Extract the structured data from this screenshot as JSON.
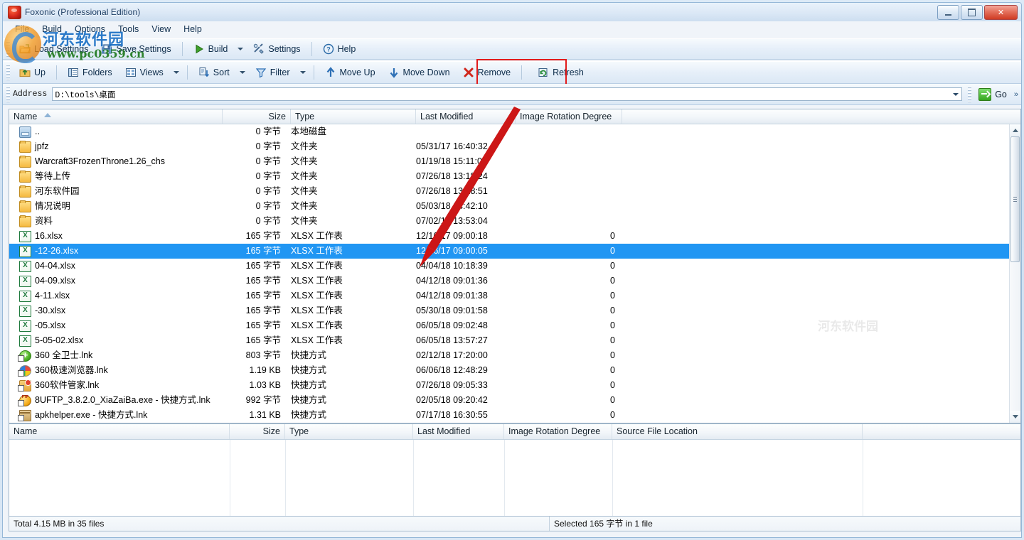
{
  "window": {
    "title": "Foxonic (Professional Edition)",
    "app_icon": "foxonic-icon",
    "minimize": "–",
    "maximize": "□",
    "close": "✕"
  },
  "menubar": {
    "items": [
      {
        "label": "File",
        "name": "menu-file"
      },
      {
        "label": "Build",
        "name": "menu-build"
      },
      {
        "label": "Options",
        "name": "menu-options"
      },
      {
        "label": "Tools",
        "name": "menu-tools"
      },
      {
        "label": "View",
        "name": "menu-view"
      },
      {
        "label": "Help",
        "name": "menu-help"
      }
    ]
  },
  "toolbar_main": {
    "load_settings": "Load Settings",
    "save_settings": "Save Settings",
    "build": "Build",
    "settings": "Settings",
    "help": "Help"
  },
  "toolbar_nav": {
    "up": "Up",
    "folders": "Folders",
    "views": "Views",
    "sort": "Sort",
    "filter": "Filter",
    "move_up": "Move Up",
    "move_down": "Move Down",
    "remove": "Remove",
    "refresh": "Refresh"
  },
  "address": {
    "label": "Address",
    "value": "D:\\tools\\桌面",
    "go": "Go",
    "overflow": "»"
  },
  "filelist": {
    "columns": [
      "Name",
      "Size",
      "Type",
      "Last Modified",
      "Image Rotation Degree"
    ],
    "sort_column": "Name",
    "sort_direction": "ascending",
    "rows": [
      {
        "icon": "drive-icon",
        "name": "..",
        "size": "0 字节",
        "type": "本地磁盘",
        "modified": "",
        "rotation": ""
      },
      {
        "icon": "folder-icon",
        "name": "jpfz",
        "size": "0 字节",
        "type": "文件夹",
        "modified": "05/31/17 16:40:32",
        "rotation": ""
      },
      {
        "icon": "folder-icon",
        "name": "Warcraft3FrozenThrone1.26_chs",
        "size": "0 字节",
        "type": "文件夹",
        "modified": "01/19/18 15:11:01",
        "rotation": ""
      },
      {
        "icon": "folder-icon",
        "name": "等待上传",
        "size": "0 字节",
        "type": "文件夹",
        "modified": "07/26/18 13:18:24",
        "rotation": ""
      },
      {
        "icon": "folder-icon",
        "name": "河东软件园",
        "size": "0 字节",
        "type": "文件夹",
        "modified": "07/26/18 13:18:51",
        "rotation": ""
      },
      {
        "icon": "folder-icon",
        "name": "情况说明",
        "size": "0 字节",
        "type": "文件夹",
        "modified": "05/03/18 14:42:10",
        "rotation": ""
      },
      {
        "icon": "folder-icon",
        "name": "资料",
        "size": "0 字节",
        "type": "文件夹",
        "modified": "07/02/18 13:53:04",
        "rotation": ""
      },
      {
        "icon": "xlsx-icon",
        "name": "16.xlsx",
        "size": "165 字节",
        "type": "XLSX 工作表",
        "modified": "12/16/17 09:00:18",
        "rotation": "0"
      },
      {
        "icon": "xlsx-icon",
        "name": "-12-26.xlsx",
        "size": "165 字节",
        "type": "XLSX 工作表",
        "modified": "12/26/17 09:00:05",
        "rotation": "0",
        "selected": true
      },
      {
        "icon": "xlsx-icon",
        "name": "04-04.xlsx",
        "size": "165 字节",
        "type": "XLSX 工作表",
        "modified": "04/04/18 10:18:39",
        "rotation": "0"
      },
      {
        "icon": "xlsx-icon",
        "name": "04-09.xlsx",
        "size": "165 字节",
        "type": "XLSX 工作表",
        "modified": "04/12/18 09:01:36",
        "rotation": "0"
      },
      {
        "icon": "xlsx-icon",
        "name": "4-11.xlsx",
        "size": "165 字节",
        "type": "XLSX 工作表",
        "modified": "04/12/18 09:01:38",
        "rotation": "0"
      },
      {
        "icon": "xlsx-icon",
        "name": "-30.xlsx",
        "size": "165 字节",
        "type": "XLSX 工作表",
        "modified": "05/30/18 09:01:58",
        "rotation": "0"
      },
      {
        "icon": "xlsx-icon",
        "name": "-05.xlsx",
        "size": "165 字节",
        "type": "XLSX 工作表",
        "modified": "06/05/18 09:02:48",
        "rotation": "0"
      },
      {
        "icon": "xlsx-icon",
        "name": "5-05-02.xlsx",
        "size": "165 字节",
        "type": "XLSX 工作表",
        "modified": "06/05/18 13:57:27",
        "rotation": "0"
      },
      {
        "icon": "360-icon",
        "name": "360  全卫士.lnk",
        "size": "803 字节",
        "type": "快捷方式",
        "modified": "02/12/18 17:20:00",
        "rotation": "0"
      },
      {
        "icon": "browser-icon",
        "name": "360极速浏览器.lnk",
        "size": "1.19 KB",
        "type": "快捷方式",
        "modified": "06/06/18 12:48:29",
        "rotation": "0"
      },
      {
        "icon": "manager-icon",
        "name": "360软件管家.lnk",
        "size": "1.03 KB",
        "type": "快捷方式",
        "modified": "07/26/18 09:05:33",
        "rotation": "0"
      },
      {
        "icon": "ftp-icon",
        "name": "8UFTP_3.8.2.0_XiaZaiBa.exe - 快捷方式.lnk",
        "size": "992 字节",
        "type": "快捷方式",
        "modified": "02/05/18 09:20:42",
        "rotation": "0"
      },
      {
        "icon": "box-icon",
        "name": "apkhelper.exe - 快捷方式.lnk",
        "size": "1.31 KB",
        "type": "快捷方式",
        "modified": "07/17/18 16:30:55",
        "rotation": "0"
      }
    ]
  },
  "bottompane": {
    "columns": [
      "Name",
      "Size",
      "Type",
      "Last Modified",
      "Image Rotation Degree",
      "Source File Location"
    ],
    "rows": []
  },
  "statusbar": {
    "total": "Total 4.15 MB in 35 files",
    "selected": "Selected 165 字节 in 1 file"
  },
  "watermark": {
    "site_cn": "河东软件园",
    "site_url": "www.pc0359.cn",
    "faint": "河东软件园"
  }
}
